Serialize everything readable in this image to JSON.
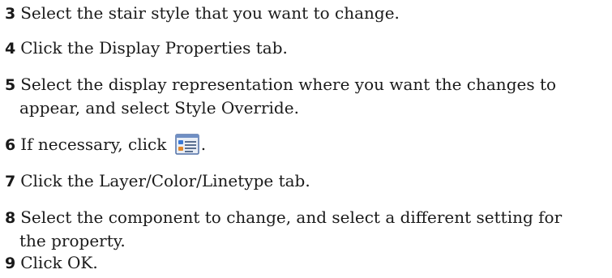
{
  "steps": [
    {
      "number": "3",
      "lines": [
        "Select the stair style that you want to change."
      ]
    },
    {
      "number": "4",
      "lines": [
        "Click the Display Properties tab."
      ]
    },
    {
      "number": "5",
      "lines": [
        "Select the display representation where you want the changes to",
        "appear, and select Style Override."
      ]
    },
    {
      "number": "6",
      "text_before": "If necessary, click",
      "icon": "edit-display-properties-icon",
      "text_after": "."
    },
    {
      "number": "7",
      "lines": [
        "Click the Layer/Color/Linetype tab."
      ]
    },
    {
      "number": "8",
      "lines": [
        "Select the component to change, and select a different setting for",
        "the property."
      ]
    },
    {
      "number": "9",
      "lines": [
        "Click OK."
      ]
    }
  ]
}
